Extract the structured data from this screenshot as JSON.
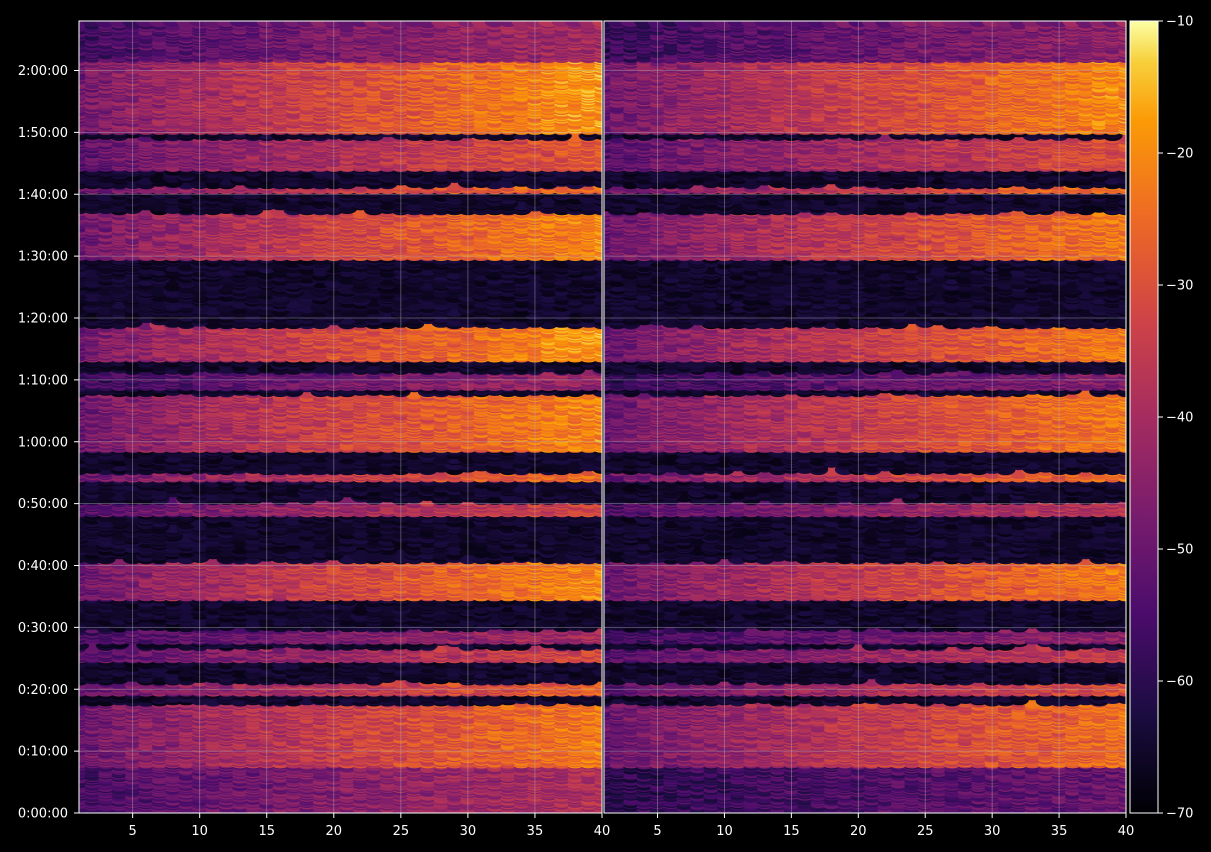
{
  "chart_data": {
    "type": "heatmap",
    "title": "",
    "xlabel": "",
    "ylabel": "",
    "colormap": "inferno",
    "background_color": "#000000",
    "text_color": "#ffffff",
    "grid": true,
    "colorbar": {
      "position": "right",
      "range": [
        -70,
        -10
      ],
      "ticks": [
        -70,
        -60,
        -50,
        -40,
        -30,
        -20,
        -10
      ],
      "tick_labels": [
        "−70",
        "−60",
        "−50",
        "−40",
        "−30",
        "−20",
        "−10"
      ]
    },
    "y_axis": {
      "unit": "seconds",
      "range": [
        0,
        7680
      ],
      "ticks": [
        0,
        600,
        1200,
        1800,
        2400,
        3000,
        3600,
        4200,
        4800,
        5400,
        6000,
        6600,
        7200
      ],
      "tick_labels": [
        "0:00:00",
        "0:10:00",
        "0:20:00",
        "0:30:00",
        "0:40:00",
        "0:50:00",
        "1:00:00",
        "1:10:00",
        "1:20:00",
        "1:30:00",
        "1:40:00",
        "1:50:00",
        "2:00:00"
      ]
    },
    "panels": [
      {
        "xlim": [
          1,
          40
        ],
        "x_ticks": [
          5,
          10,
          15,
          20,
          25,
          30,
          35,
          40
        ],
        "x_tick_labels": [
          "5",
          "10",
          "15",
          "20",
          "25",
          "30",
          "35",
          "40"
        ],
        "activity_bands": [
          {
            "range": [
              0,
              480
            ],
            "peak": -38
          },
          {
            "range": [
              480,
              1080
            ],
            "peak": -22
          },
          {
            "range": [
              1180,
              1280
            ],
            "peak": -26
          },
          {
            "range": [
              1500,
              1620
            ],
            "peak": -32
          },
          {
            "range": [
              1680,
              1800
            ],
            "peak": -40
          },
          {
            "range": [
              2100,
              2460
            ],
            "peak": -20
          },
          {
            "range": [
              2920,
              3040
            ],
            "peak": -32
          },
          {
            "range": [
              3250,
              3330
            ],
            "peak": -24
          },
          {
            "range": [
              3540,
              4080
            ],
            "peak": -20
          },
          {
            "range": [
              4140,
              4300
            ],
            "peak": -42
          },
          {
            "range": [
              4420,
              4740
            ],
            "peak": -18
          },
          {
            "range": [
              5400,
              5850
            ],
            "peak": -20
          },
          {
            "range": [
              6050,
              6100
            ],
            "peak": -24
          },
          {
            "range": [
              6260,
              6570
            ],
            "peak": -28
          },
          {
            "range": [
              6620,
              7320
            ],
            "peak": -18
          },
          {
            "range": [
              7320,
              7680
            ],
            "peak": -40
          }
        ]
      },
      {
        "xlim": [
          1,
          40
        ],
        "x_ticks": [
          5,
          10,
          15,
          20,
          25,
          30,
          35,
          40
        ],
        "x_tick_labels": [
          "5",
          "10",
          "15",
          "20",
          "25",
          "30",
          "35",
          "40"
        ],
        "activity_bands": [
          {
            "range": [
              0,
              480
            ],
            "peak": -50
          },
          {
            "range": [
              480,
              1080
            ],
            "peak": -24
          },
          {
            "range": [
              1180,
              1280
            ],
            "peak": -30
          },
          {
            "range": [
              1500,
              1620
            ],
            "peak": -34
          },
          {
            "range": [
              1680,
              1800
            ],
            "peak": -44
          },
          {
            "range": [
              2100,
              2460
            ],
            "peak": -22
          },
          {
            "range": [
              2920,
              3040
            ],
            "peak": -36
          },
          {
            "range": [
              3250,
              3330
            ],
            "peak": -24
          },
          {
            "range": [
              3540,
              4080
            ],
            "peak": -22
          },
          {
            "range": [
              4140,
              4300
            ],
            "peak": -46
          },
          {
            "range": [
              4420,
              4740
            ],
            "peak": -22
          },
          {
            "range": [
              5400,
              5850
            ],
            "peak": -22
          },
          {
            "range": [
              6050,
              6100
            ],
            "peak": -24
          },
          {
            "range": [
              6260,
              6570
            ],
            "peak": -30
          },
          {
            "range": [
              6620,
              7320
            ],
            "peak": -20
          },
          {
            "range": [
              7320,
              7680
            ],
            "peak": -44
          }
        ]
      }
    ]
  }
}
